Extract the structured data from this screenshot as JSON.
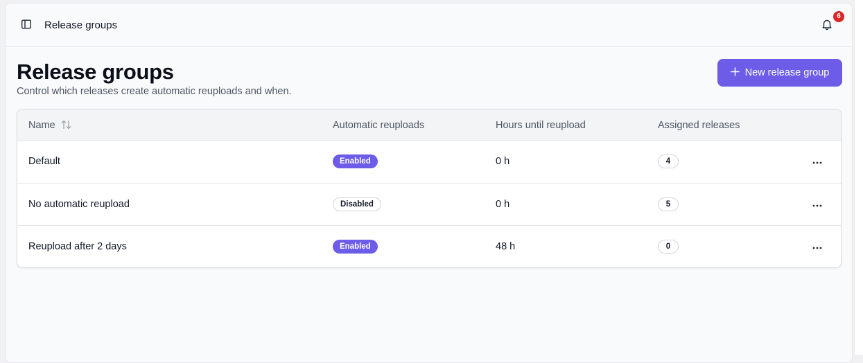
{
  "topbar": {
    "title": "Release groups",
    "notification_count": "6"
  },
  "header": {
    "title": "Release groups",
    "subtitle": "Control which releases create automatic reuploads and when.",
    "new_button_label": "New release group"
  },
  "table": {
    "columns": [
      "Name",
      "Automatic reuploads",
      "Hours until reupload",
      "Assigned releases"
    ],
    "rows": [
      {
        "name": "Default",
        "status": "Enabled",
        "hours": "0 h",
        "assigned": "4"
      },
      {
        "name": "No automatic reupload",
        "status": "Disabled",
        "hours": "0 h",
        "assigned": "5"
      },
      {
        "name": "Reupload after 2 days",
        "status": "Enabled",
        "hours": "48 h",
        "assigned": "0"
      }
    ]
  },
  "colors": {
    "accent": "#6c5ce7",
    "badge": "#dc2626"
  }
}
